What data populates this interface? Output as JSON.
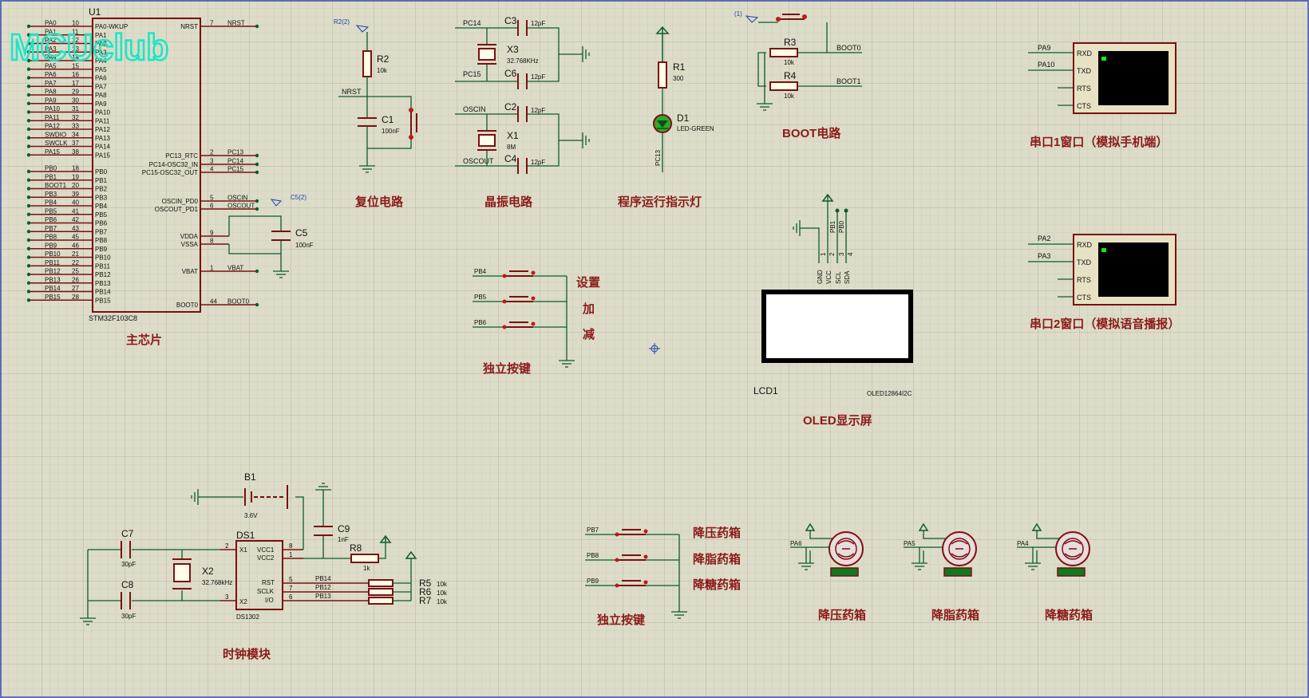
{
  "watermark": "MCUclub",
  "mcu": {
    "ref": "U1",
    "part": "STM32F103C8",
    "section_title": "主芯片",
    "left_pins": [
      {
        "net": "PA0",
        "num": "10",
        "name": "PA0-WKUP"
      },
      {
        "net": "PA1",
        "num": "11",
        "name": "PA1"
      },
      {
        "net": "PA2",
        "num": "12",
        "name": "PA2"
      },
      {
        "net": "PA3",
        "num": "13",
        "name": "PA3"
      },
      {
        "net": "PA4",
        "num": "14",
        "name": "PA4"
      },
      {
        "net": "PA5",
        "num": "15",
        "name": "PA5"
      },
      {
        "net": "PA6",
        "num": "16",
        "name": "PA6"
      },
      {
        "net": "PA7",
        "num": "17",
        "name": "PA7"
      },
      {
        "net": "PA8",
        "num": "29",
        "name": "PA8"
      },
      {
        "net": "PA9",
        "num": "30",
        "name": "PA9"
      },
      {
        "net": "PA10",
        "num": "31",
        "name": "PA10"
      },
      {
        "net": "PA11",
        "num": "32",
        "name": "PA11"
      },
      {
        "net": "PA12",
        "num": "33",
        "name": "PA12"
      },
      {
        "net": "SWDIO",
        "num": "34",
        "name": "PA13"
      },
      {
        "net": "SWCLK",
        "num": "37",
        "name": "PA14"
      },
      {
        "net": "PA15",
        "num": "38",
        "name": "PA15"
      },
      {
        "net": "PB0",
        "num": "18",
        "name": "PB0"
      },
      {
        "net": "PB1",
        "num": "19",
        "name": "PB1"
      },
      {
        "net": "BOOT1",
        "num": "20",
        "name": "PB2"
      },
      {
        "net": "PB3",
        "num": "39",
        "name": "PB3"
      },
      {
        "net": "PB4",
        "num": "40",
        "name": "PB4"
      },
      {
        "net": "PB5",
        "num": "41",
        "name": "PB5"
      },
      {
        "net": "PB6",
        "num": "42",
        "name": "PB6"
      },
      {
        "net": "PB7",
        "num": "43",
        "name": "PB7"
      },
      {
        "net": "PB8",
        "num": "45",
        "name": "PB8"
      },
      {
        "net": "PB9",
        "num": "46",
        "name": "PB9"
      },
      {
        "net": "PB10",
        "num": "21",
        "name": "PB10"
      },
      {
        "net": "PB11",
        "num": "22",
        "name": "PB11"
      },
      {
        "net": "PB12",
        "num": "25",
        "name": "PB12"
      },
      {
        "net": "PB13",
        "num": "26",
        "name": "PB13"
      },
      {
        "net": "PB14",
        "num": "27",
        "name": "PB14"
      },
      {
        "net": "PB15",
        "num": "28",
        "name": "PB15"
      }
    ],
    "right_pins": [
      {
        "name": "NRST",
        "num": "7",
        "net": "NRST"
      },
      {
        "name": "PC13_RTC",
        "num": "2",
        "net": "PC13"
      },
      {
        "name": "PC14-OSC32_IN",
        "num": "3",
        "net": "PC14"
      },
      {
        "name": "PC15-OSC32_OUT",
        "num": "4",
        "net": "PC15"
      },
      {
        "name": "OSCIN_PD0",
        "num": "5",
        "net": "OSCIN"
      },
      {
        "name": "OSCOUT_PD1",
        "num": "6",
        "net": "OSCOUT"
      },
      {
        "name": "VDDA",
        "num": "9",
        "net": ""
      },
      {
        "name": "VSSA",
        "num": "8",
        "net": ""
      },
      {
        "name": "VBAT",
        "num": "1",
        "net": "VBAT"
      },
      {
        "name": "BOOT0",
        "num": "44",
        "net": "BOOT0"
      }
    ],
    "c5": {
      "ref": "C5",
      "value": "100nF",
      "probe": "C5(2)"
    }
  },
  "reset": {
    "title": "复位电路",
    "probe": "R2(2)",
    "r2": {
      "ref": "R2",
      "value": "10k"
    },
    "c1": {
      "ref": "C1",
      "value": "100nF"
    },
    "net": "NRST"
  },
  "crystal": {
    "title": "晶振电路",
    "x3": {
      "ref": "X3",
      "value": "32.768KHz"
    },
    "x1": {
      "ref": "X1",
      "value": "8M"
    },
    "c3": {
      "ref": "C3",
      "value": "12pF"
    },
    "c6": {
      "ref": "C6",
      "value": "12pF"
    },
    "c2": {
      "ref": "C2",
      "value": "12pF"
    },
    "c4": {
      "ref": "C4",
      "value": "12pF"
    },
    "nets": [
      "PC14",
      "PC15",
      "OSCIN",
      "OSCOUT"
    ]
  },
  "led": {
    "title": "程序运行指示灯",
    "r1": {
      "ref": "R1",
      "value": "300"
    },
    "d1": {
      "ref": "D1",
      "value": "LED-GREEN"
    },
    "net": "PC13"
  },
  "boot": {
    "title": "BOOT电路",
    "probe": "(1)",
    "r3": {
      "ref": "R3",
      "value": "10k"
    },
    "r4": {
      "ref": "R4",
      "value": "10k"
    },
    "nets": [
      "BOOT0",
      "BOOT1"
    ]
  },
  "uart1": {
    "title": "串口1窗口（模拟手机端）",
    "nets": [
      "PA9",
      "PA10"
    ],
    "pins": [
      "RXD",
      "TXD",
      "RTS",
      "CTS"
    ]
  },
  "uart2": {
    "title": "串口2窗口（模拟语音播报）",
    "nets": [
      "PA2",
      "PA3"
    ],
    "pins": [
      "RXD",
      "TXD",
      "RTS",
      "CTS"
    ]
  },
  "oled": {
    "title": "OLED显示屏",
    "ref": "LCD1",
    "part": "OLED12864I2C",
    "pins": [
      "GND",
      "VCC",
      "SCL",
      "SDA"
    ],
    "pin_nums": [
      "1",
      "2",
      "3",
      "4"
    ],
    "nets": [
      "PB1",
      "PB0"
    ]
  },
  "keys1": {
    "title": "独立按键",
    "nets": [
      "PB4",
      "PB5",
      "PB6"
    ],
    "labels": [
      "设置",
      "加",
      "减"
    ]
  },
  "keys2": {
    "title": "独立按键",
    "nets": [
      "PB7",
      "PB8",
      "PB9"
    ],
    "labels": [
      "降压药箱",
      "降脂药箱",
      "降糖药箱"
    ]
  },
  "clock": {
    "title": "时钟模块",
    "b1": {
      "ref": "B1",
      "value": "3.6V"
    },
    "c7": {
      "ref": "C7",
      "value": "30pF"
    },
    "c8": {
      "ref": "C8",
      "value": "30pF"
    },
    "c9": {
      "ref": "C9",
      "value": "1nF"
    },
    "x2": {
      "ref": "X2",
      "value": "32.768kHz"
    },
    "r8": {
      "ref": "R8",
      "value": "1k"
    },
    "ds1": {
      "ref": "DS1",
      "part": "DS1302",
      "left_pins": [
        {
          "num": "2",
          "name": "X1"
        },
        {
          "num": "3",
          "name": "X2"
        }
      ],
      "right_pins": [
        {
          "num": "8",
          "name": "VCC1"
        },
        {
          "num": "1",
          "name": "VCC2"
        },
        {
          "num": "5",
          "name": "RST"
        },
        {
          "num": "7",
          "name": "SCLK"
        },
        {
          "num": "6",
          "name": "I/O"
        }
      ]
    },
    "nets": [
      "PB14",
      "PB12",
      "PB13"
    ],
    "r5": {
      "ref": "R5",
      "value": "10k"
    },
    "r6": {
      "ref": "R6",
      "value": "10k"
    },
    "r7": {
      "ref": "R7",
      "value": "10k"
    }
  },
  "motors": [
    {
      "net": "PA6",
      "title": "降压药箱"
    },
    {
      "net": "PA5",
      "title": "降脂药箱"
    },
    {
      "net": "PA4",
      "title": "降糖药箱"
    }
  ],
  "colors": {
    "grid_bg": "#dcdcc8",
    "wire": "#0b5d2c",
    "component": "#7b1010",
    "section_title": "#8b1a1a",
    "watermark": "#19e6c8",
    "led_green": "#2ea82e",
    "terminal_screen": "#000000"
  }
}
